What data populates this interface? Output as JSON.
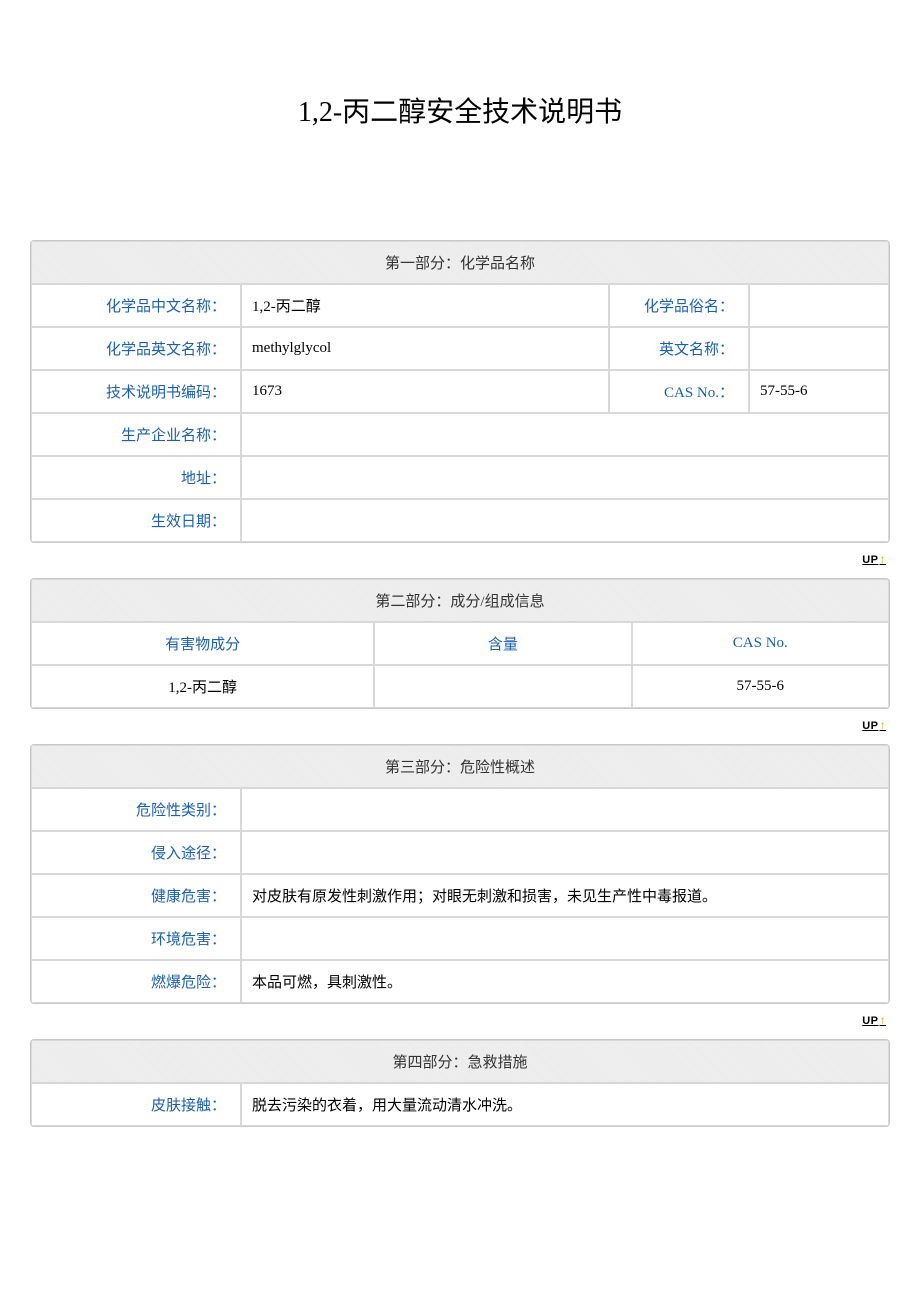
{
  "title": "1,2-丙二醇安全技术说明书",
  "up_label": "UP",
  "section1": {
    "header": "第一部分：化学品名称",
    "labels": {
      "cn_name": "化学品中文名称：",
      "common_name": "化学品俗名：",
      "en_name": "化学品英文名称：",
      "en_common": "英文名称：",
      "manual_code": "技术说明书编码：",
      "cas_no": "CAS No.：",
      "manufacturer": "生产企业名称：",
      "address": "地址：",
      "effective_date": "生效日期："
    },
    "values": {
      "cn_name": "1,2-丙二醇",
      "common_name": "",
      "en_name": "methylglycol",
      "en_common": "",
      "manual_code": "1673",
      "cas_no": "57-55-6",
      "manufacturer": "",
      "address": "",
      "effective_date": ""
    }
  },
  "section2": {
    "header": "第二部分：成分/组成信息",
    "columns": {
      "ingredient": "有害物成分",
      "content": "含量",
      "cas": "CAS No."
    },
    "row": {
      "ingredient": "1,2-丙二醇",
      "content": "",
      "cas": "57-55-6"
    }
  },
  "section3": {
    "header": "第三部分：危险性概述",
    "labels": {
      "category": "危险性类别：",
      "route": "侵入途径：",
      "health": "健康危害：",
      "environment": "环境危害：",
      "fire": "燃爆危险："
    },
    "values": {
      "category": "",
      "route": "",
      "health": "对皮肤有原发性刺激作用；对眼无刺激和损害，未见生产性中毒报道。",
      "environment": "",
      "fire": "本品可燃，具刺激性。"
    }
  },
  "section4": {
    "header": "第四部分：急救措施",
    "labels": {
      "skin": "皮肤接触："
    },
    "values": {
      "skin": "脱去污染的衣着，用大量流动清水冲洗。"
    }
  }
}
